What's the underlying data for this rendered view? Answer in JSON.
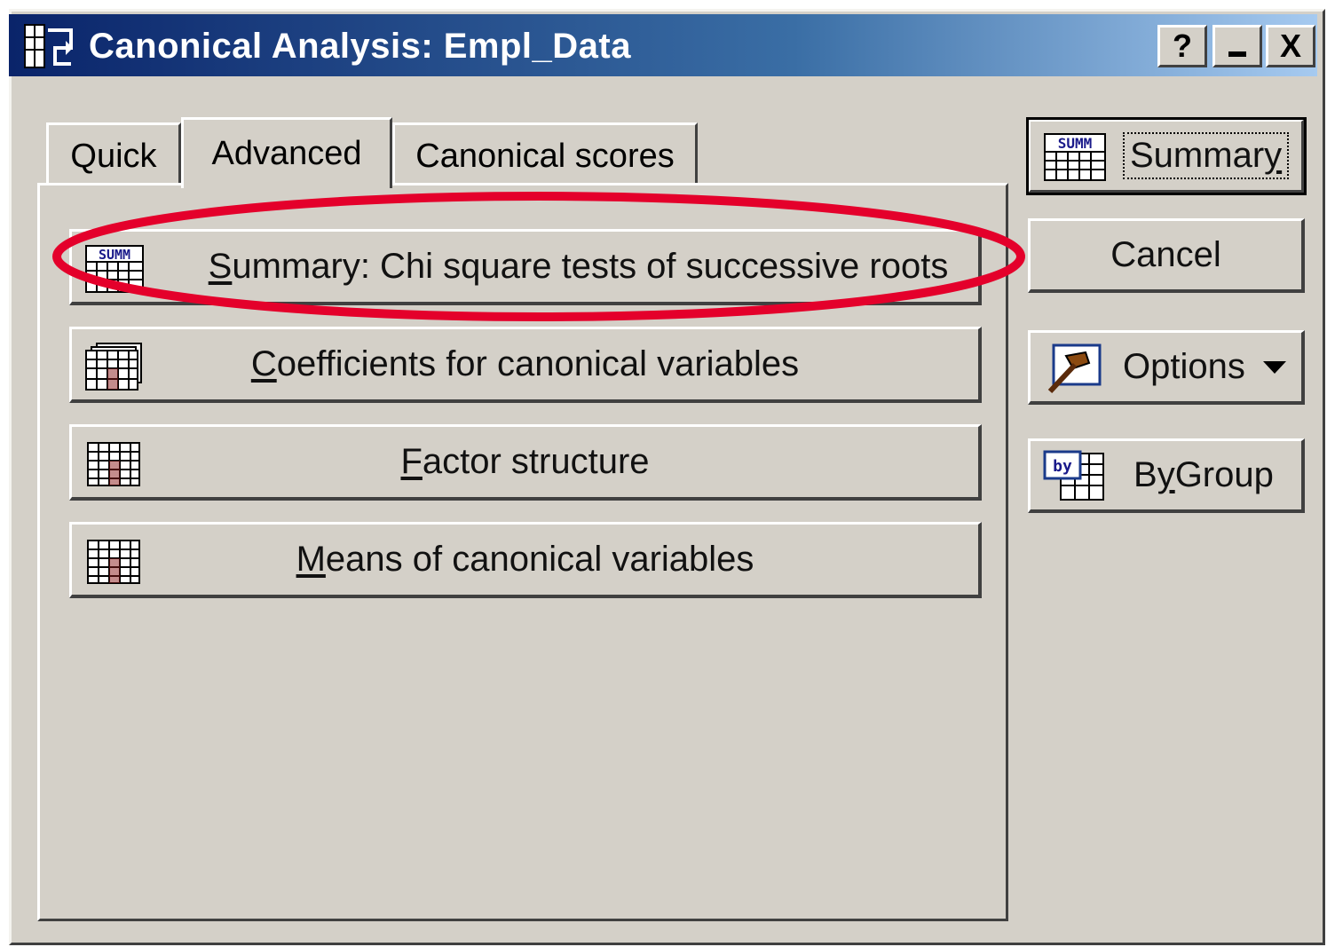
{
  "window": {
    "title": "Canonical Analysis: Empl_Data",
    "help_button": "?",
    "minimize_button": "_",
    "close_button": "X"
  },
  "tabs": [
    {
      "label": "Quick",
      "active": false
    },
    {
      "label": "Advanced",
      "active": true
    },
    {
      "label": "Canonical scores",
      "active": false
    }
  ],
  "panel_buttons": [
    {
      "icon": "summary-table-icon",
      "mnemonic": "S",
      "rest": "ummary:  Chi square tests of successive roots",
      "highlighted": true
    },
    {
      "icon": "spreadsheet-icon",
      "mnemonic": "C",
      "rest": "oefficients for canonical variables"
    },
    {
      "icon": "grid-icon",
      "mnemonic": "F",
      "rest": "actor structure"
    },
    {
      "icon": "grid-icon",
      "mnemonic": "M",
      "rest": "eans of canonical variables"
    }
  ],
  "side_buttons": {
    "summary": {
      "pre": "Summar",
      "mnemonic": "y",
      "icon": "summary-table-icon"
    },
    "cancel": {
      "label": "Cancel"
    },
    "options": {
      "label": "Options",
      "icon": "hammer-icon",
      "arrow": "dropdown-arrow-icon"
    },
    "by_group": {
      "pre": "B",
      "mnemonic": "y",
      "post": " Group",
      "icon": "by-group-icon"
    }
  },
  "annotation": {
    "color": "#e4002b",
    "shape": "ellipse"
  }
}
